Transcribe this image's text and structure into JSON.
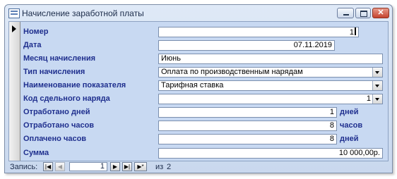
{
  "window": {
    "title": "Начисление заработной платы",
    "controls": {
      "minimize": "–",
      "maximize": "□",
      "close": "✕"
    }
  },
  "form": {
    "fields": [
      {
        "label": "Номер",
        "value": "1",
        "align": "right",
        "type": "text",
        "has_caret": true
      },
      {
        "label": "Дата",
        "value": "07.11.2019",
        "align": "right",
        "type": "text"
      },
      {
        "label": "Месяц начисления",
        "value": "Июнь",
        "align": "left",
        "type": "text"
      },
      {
        "label": "Тип начисления",
        "value": "Оплата по производственным нарядам",
        "align": "left",
        "type": "combo"
      },
      {
        "label": "Наименование показателя",
        "value": "Тарифная ставка",
        "align": "left",
        "type": "combo"
      },
      {
        "label": "Код сдельного наряда",
        "value": "1",
        "align": "right",
        "type": "combo"
      },
      {
        "label": "Отработано дней",
        "value": "1",
        "align": "right",
        "type": "text",
        "unit": "дней"
      },
      {
        "label": "Отработано часов",
        "value": "8",
        "align": "right",
        "type": "text",
        "unit": "часов"
      },
      {
        "label": "Оплачено часов",
        "value": "8",
        "align": "right",
        "type": "text",
        "unit": "дней"
      },
      {
        "label": "Сумма",
        "value": "10 000,00р.",
        "align": "right",
        "type": "text"
      }
    ]
  },
  "navigation": {
    "label": "Запись:",
    "current": "1",
    "of_label": "из",
    "total": "2",
    "buttons": {
      "first": "|◀",
      "prev": "◀",
      "next": "▶",
      "last": "▶|",
      "new": "▶*"
    }
  },
  "colors": {
    "label_text": "#1f2f8e",
    "form_background": "#c8d9f2"
  }
}
